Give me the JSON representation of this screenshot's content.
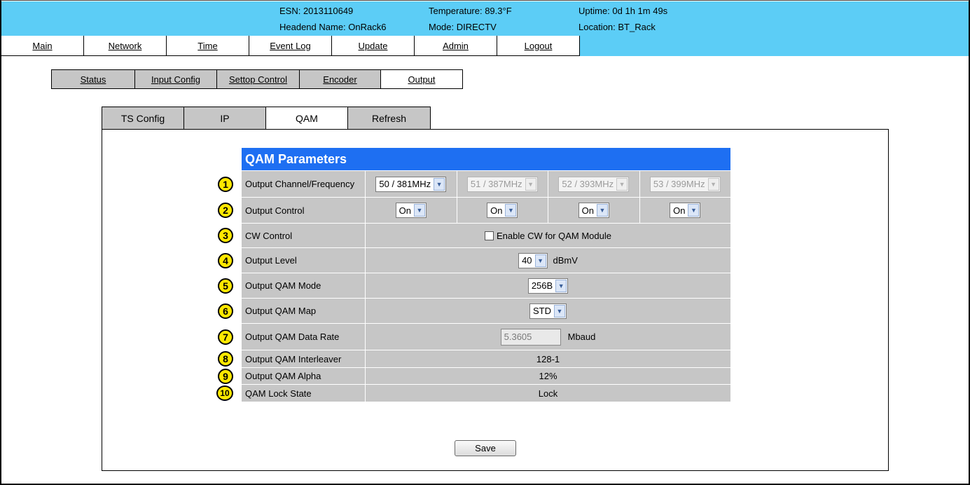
{
  "header": {
    "esn": "ESN: 2013110649",
    "headend_name": "Headend Name: OnRack6",
    "temperature": "Temperature: 89.3°F",
    "mode": "Mode: DIRECTV",
    "uptime": "Uptime: 0d 1h 1m 49s",
    "location": "Location: BT_Rack",
    "bg_color": "#5ccdf6"
  },
  "main_nav": [
    "Main",
    "Network",
    "Time",
    "Event Log",
    "Update",
    "Admin",
    "Logout"
  ],
  "sub_nav": [
    "Status",
    "Input Config",
    "Settop Control",
    "Encoder",
    "Output"
  ],
  "sub_nav_active": "Output",
  "tabs": [
    "TS Config",
    "IP",
    "QAM",
    "Refresh"
  ],
  "tabs_active": "QAM",
  "qam": {
    "title": "QAM Parameters",
    "title_color": "#1e6ff2",
    "rows": {
      "channel": {
        "num": "1",
        "label": "Output Channel/Frequency",
        "values": [
          "50 / 381MHz",
          "51 / 387MHz",
          "52 / 393MHz",
          "53 / 399MHz"
        ]
      },
      "control": {
        "num": "2",
        "label": "Output Control",
        "values": [
          "On",
          "On",
          "On",
          "On"
        ]
      },
      "cw": {
        "num": "3",
        "label": "CW Control",
        "checkbox_label": "Enable CW for QAM Module"
      },
      "level": {
        "num": "4",
        "label": "Output Level",
        "value": "40",
        "unit": "dBmV"
      },
      "mode": {
        "num": "5",
        "label": "Output QAM Mode",
        "value": "256B"
      },
      "map": {
        "num": "6",
        "label": "Output QAM Map",
        "value": "STD"
      },
      "rate": {
        "num": "7",
        "label": "Output QAM Data Rate",
        "value": "5.3605",
        "unit": "Mbaud"
      },
      "interleaver": {
        "num": "8",
        "label": "Output QAM Interleaver",
        "value": "128-1"
      },
      "alpha": {
        "num": "9",
        "label": "Output QAM Alpha",
        "value": "12%"
      },
      "lock": {
        "num": "10",
        "label": "QAM Lock State",
        "value": "Lock"
      }
    }
  },
  "save_label": "Save"
}
